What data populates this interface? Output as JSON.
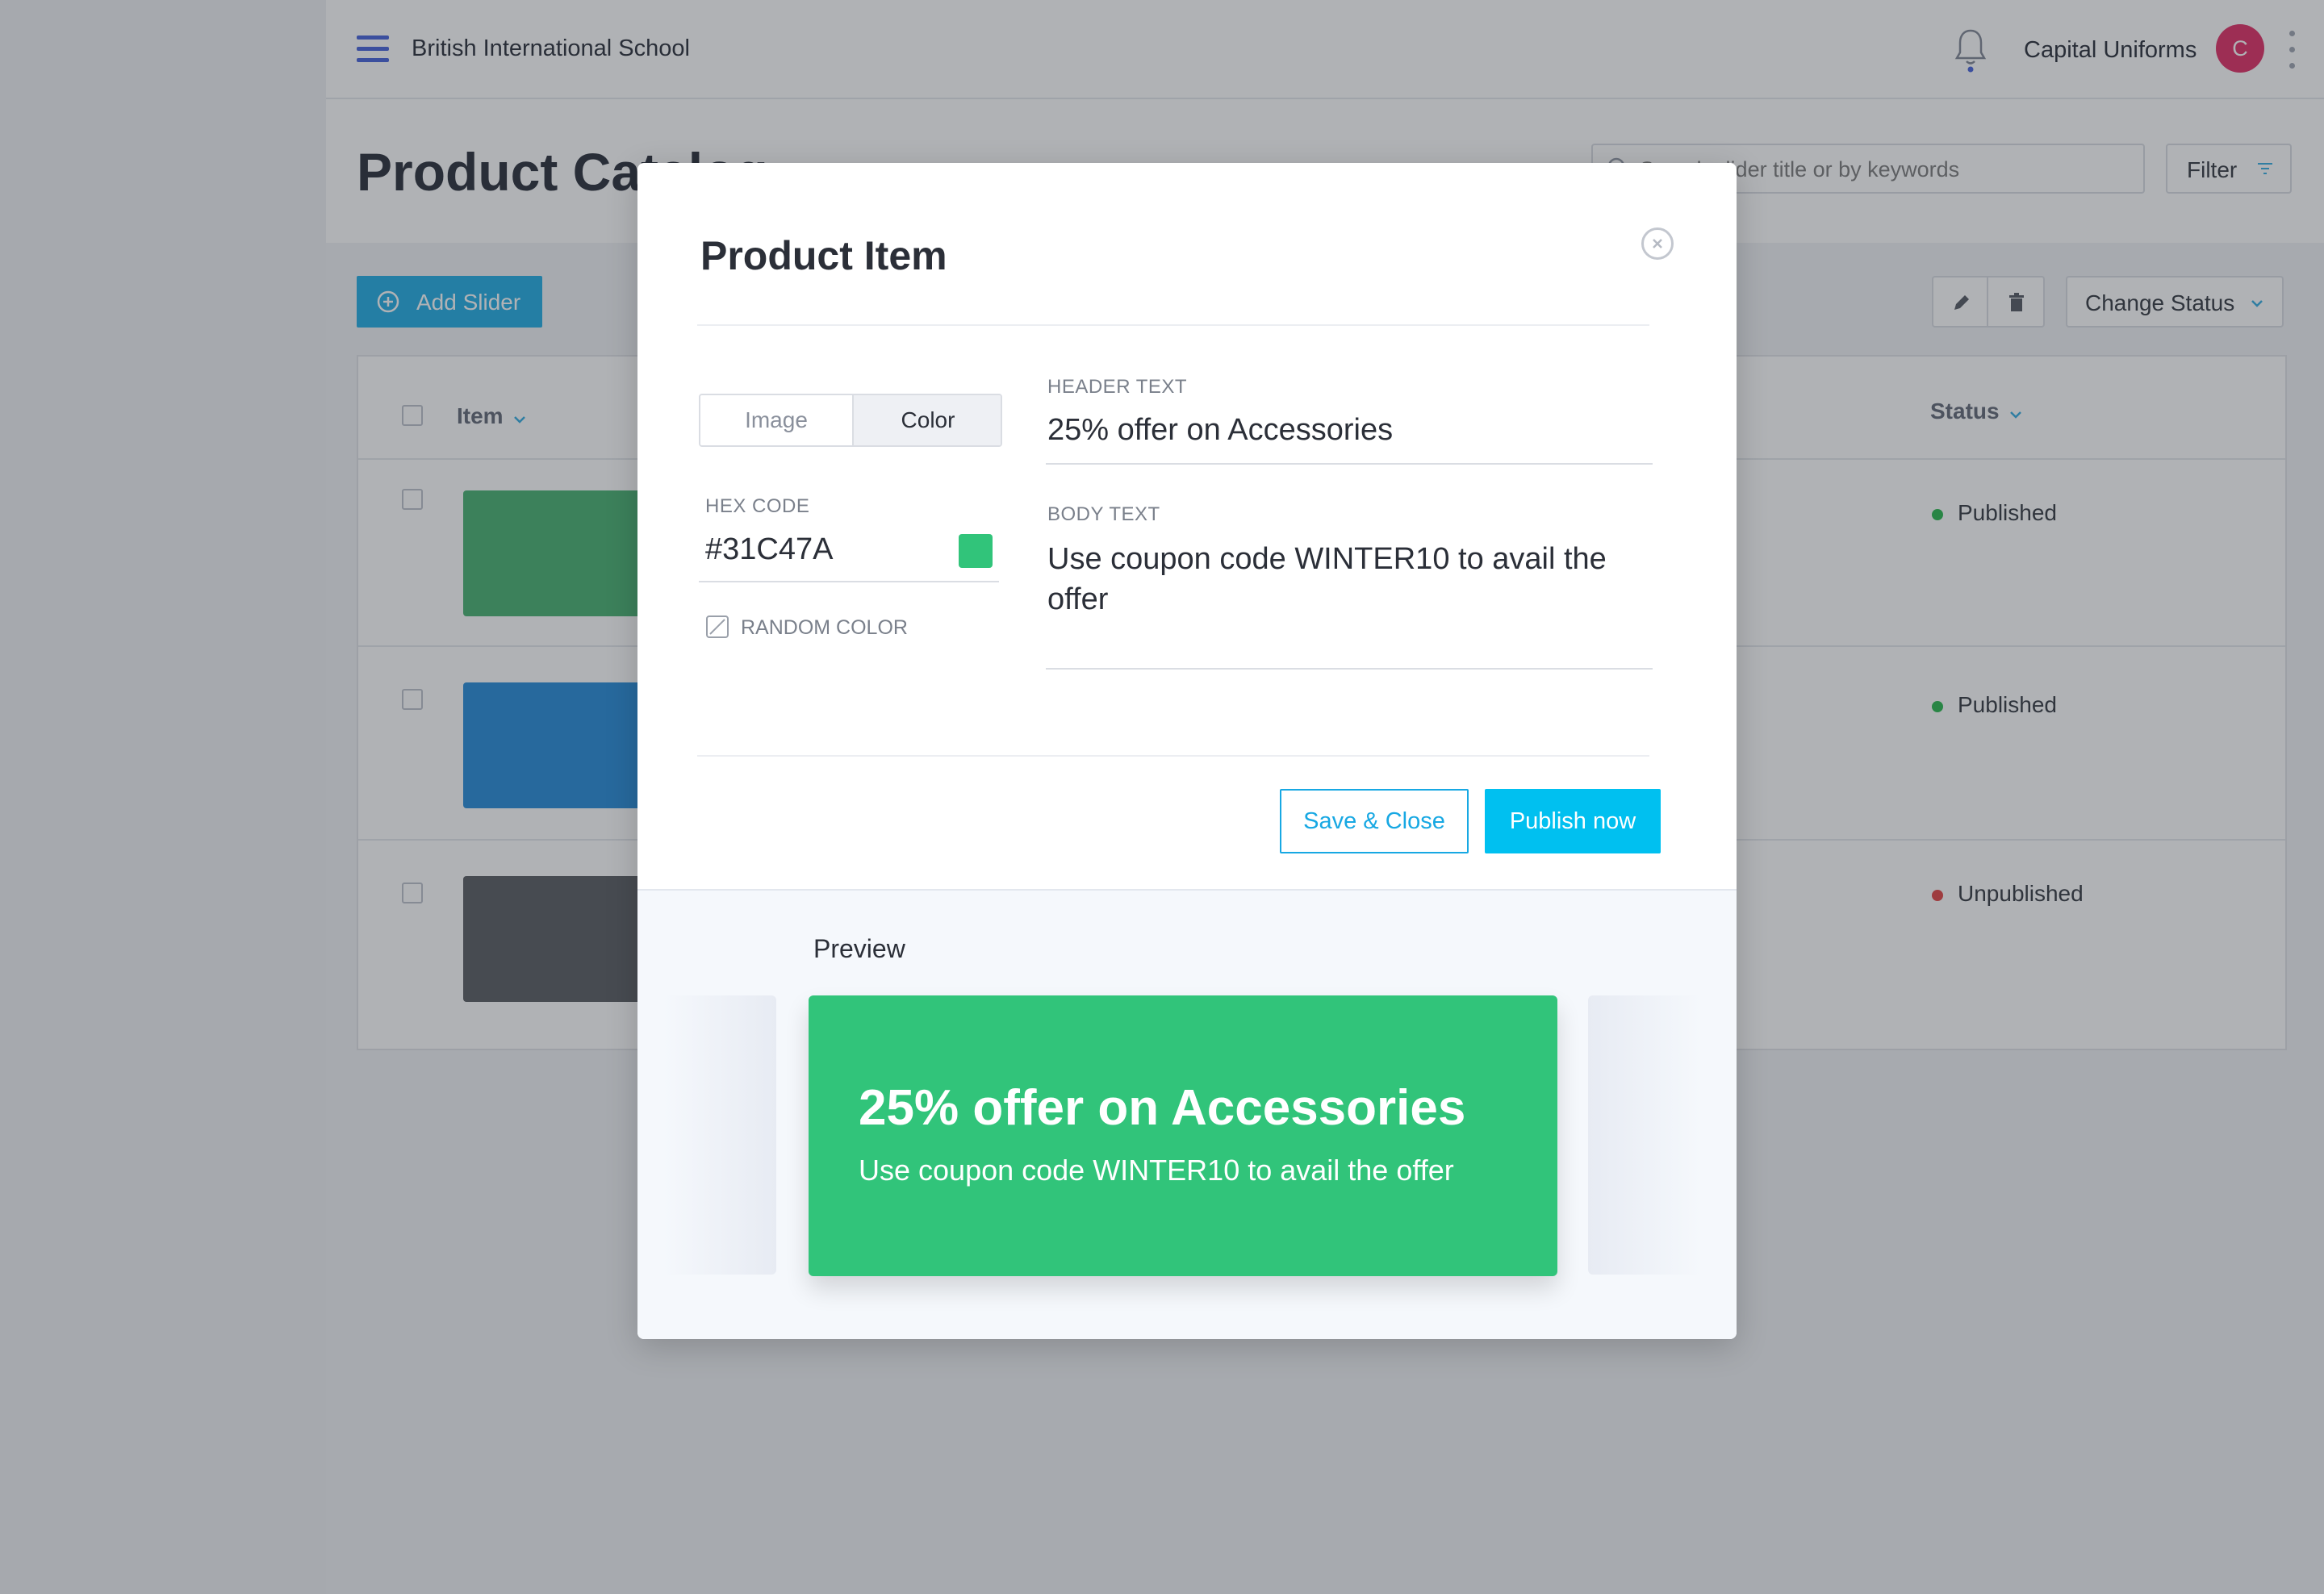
{
  "topbar": {
    "school_name": "British International School",
    "account_name": "Capital Uniforms",
    "avatar_initial": "C"
  },
  "page": {
    "title": "Product Catalog",
    "search_placeholder": "Search slider title or by keywords",
    "filter_label": "Filter",
    "add_slider_label": "Add Slider",
    "change_status_label": "Change Status"
  },
  "table": {
    "columns": {
      "item": "Item",
      "status": "Status"
    },
    "rows": [
      {
        "thumb_color": "#3fae6a",
        "status": "Published",
        "status_color": "#1fb545"
      },
      {
        "thumb_color": "#1b86d8",
        "status": "Published",
        "status_color": "#1fb545"
      },
      {
        "thumb_color": "#505459",
        "status": "Unpublished",
        "status_color": "#e23b3b"
      }
    ]
  },
  "modal": {
    "title": "Product Item",
    "type_options": [
      "Image",
      "Color"
    ],
    "selected_type": "Color",
    "hex_label": "HEX CODE",
    "hex_value": "#31C47A",
    "random_color_label": "RANDOM COLOR",
    "header_label": "HEADER TEXT",
    "header_value": "25% offer on Accessories",
    "body_label": "BODY TEXT",
    "body_value": "Use coupon code WINTER10 to avail the offer",
    "save_close_label": "Save & Close",
    "publish_label": "Publish now",
    "preview_label": "Preview"
  },
  "preview": {
    "header": "25% offer on Accessories",
    "body": "Use coupon code WINTER10 to avail the offer",
    "background_color": "#31C47A"
  },
  "colors": {
    "accent": "#17a8e3",
    "primary_button": "#00c0f0",
    "menu_icon": "#3d5bd9"
  },
  "icons": [
    "menu-icon",
    "bell-icon",
    "more-vertical-icon",
    "search-icon",
    "filter-icon",
    "plus-circle-icon",
    "pencil-icon",
    "trash-icon",
    "chevron-down-icon",
    "close-icon",
    "random-color-icon"
  ]
}
